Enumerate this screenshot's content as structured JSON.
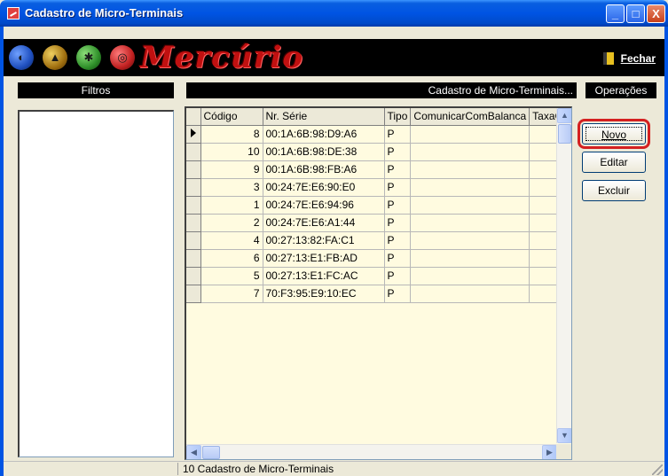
{
  "window": {
    "title": "Cadastro de Micro-Terminais",
    "minimize": "_",
    "maximize": "□",
    "close": "X"
  },
  "banner": {
    "logo": "Mercúrio",
    "icons": [
      "blue-ball-icon",
      "yellow-ball-icon",
      "green-ball-icon",
      "red-ball-icon"
    ],
    "close_label": "Fechar"
  },
  "panels": {
    "filtros": "Filtros",
    "cadastro": "Cadastro de Micro-Terminais...",
    "operacoes": "Operações"
  },
  "grid": {
    "columns": [
      "Código",
      "Nr. Série",
      "Tipo",
      "ComunicarComBalanca",
      "TaxaC"
    ],
    "rows": [
      {
        "codigo": "8",
        "serie": "00:1A:6B:98:D9:A6",
        "tipo": "P"
      },
      {
        "codigo": "10",
        "serie": "00:1A:6B:98:DE:38",
        "tipo": "P"
      },
      {
        "codigo": "9",
        "serie": "00:1A:6B:98:FB:A6",
        "tipo": "P"
      },
      {
        "codigo": "3",
        "serie": "00:24:7E:E6:90:E0",
        "tipo": "P"
      },
      {
        "codigo": "1",
        "serie": "00:24:7E:E6:94:96",
        "tipo": "P"
      },
      {
        "codigo": "2",
        "serie": "00:24:7E:E6:A1:44",
        "tipo": "P"
      },
      {
        "codigo": "4",
        "serie": "00:27:13:82:FA:C1",
        "tipo": "P"
      },
      {
        "codigo": "6",
        "serie": "00:27:13:E1:FB:AD",
        "tipo": "P"
      },
      {
        "codigo": "5",
        "serie": "00:27:13:E1:FC:AC",
        "tipo": "P"
      },
      {
        "codigo": "7",
        "serie": "70:F3:95:E9:10:EC",
        "tipo": "P"
      }
    ]
  },
  "operations": {
    "novo": "Novo",
    "editar": "Editar",
    "excluir": "Excluir"
  },
  "status": {
    "text": "10 Cadastro de Micro-Terminais"
  },
  "colors": {
    "titlebar": "#0054E3",
    "grid_bg": "#FFFBE0",
    "logo": "#C01010",
    "highlight": "#D42020"
  }
}
